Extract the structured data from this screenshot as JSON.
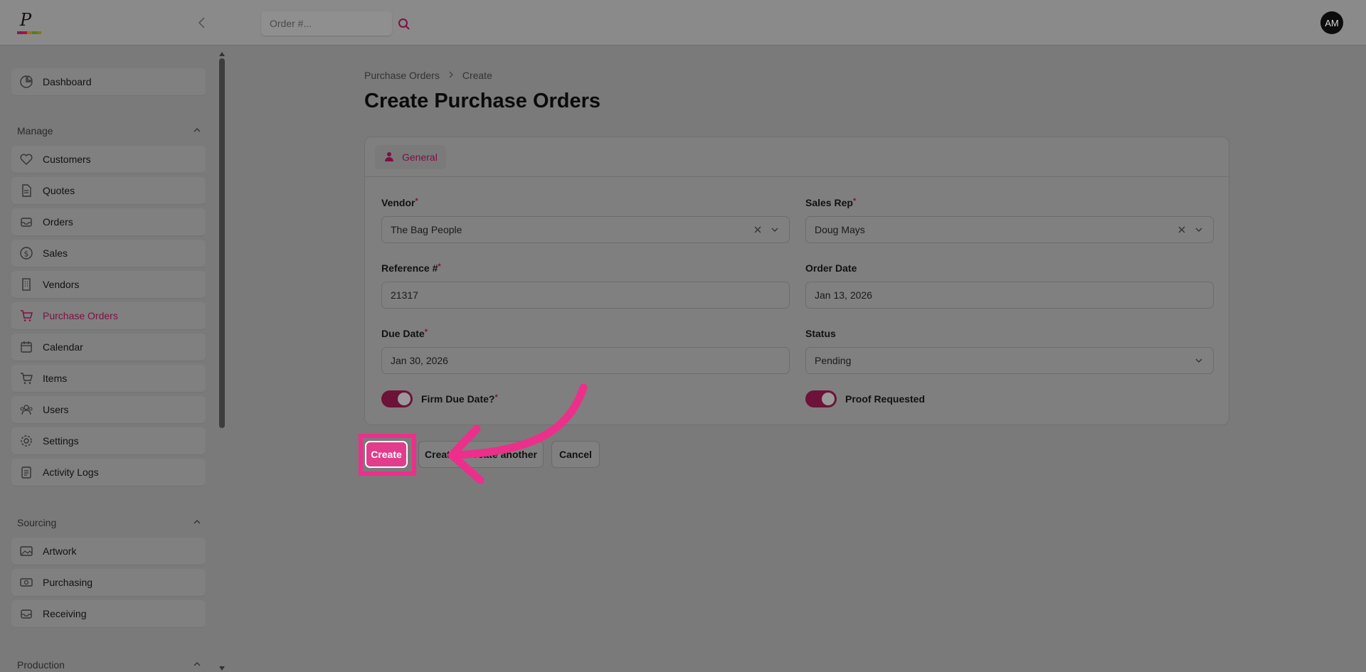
{
  "topbar": {
    "search_placeholder": "Order #...",
    "avatar_initials": "AM"
  },
  "sidebar": {
    "items": [
      {
        "label": "Dashboard",
        "icon": "pie-chart-icon"
      }
    ],
    "sections": [
      {
        "title": "Manage",
        "items": [
          {
            "label": "Customers",
            "icon": "heart-icon"
          },
          {
            "label": "Quotes",
            "icon": "document-icon"
          },
          {
            "label": "Orders",
            "icon": "inbox-icon"
          },
          {
            "label": "Sales",
            "icon": "dollar-icon"
          },
          {
            "label": "Vendors",
            "icon": "building-icon"
          },
          {
            "label": "Purchase Orders",
            "icon": "cart-icon",
            "active": true
          },
          {
            "label": "Calendar",
            "icon": "calendar-icon"
          },
          {
            "label": "Items",
            "icon": "cart-icon"
          },
          {
            "label": "Users",
            "icon": "users-icon"
          },
          {
            "label": "Settings",
            "icon": "gear-icon"
          },
          {
            "label": "Activity Logs",
            "icon": "clipboard-icon"
          }
        ]
      },
      {
        "title": "Sourcing",
        "items": [
          {
            "label": "Artwork",
            "icon": "image-icon"
          },
          {
            "label": "Purchasing",
            "icon": "cash-icon"
          },
          {
            "label": "Receiving",
            "icon": "inbox-icon"
          }
        ]
      },
      {
        "title": "Production",
        "items": []
      }
    ]
  },
  "breadcrumb": [
    "Purchase Orders",
    "Create"
  ],
  "page_title": "Create Purchase Orders",
  "form": {
    "tab_label": "General",
    "vendor": {
      "label": "Vendor",
      "value": "The Bag People",
      "required": true
    },
    "sales_rep": {
      "label": "Sales Rep",
      "value": "Doug Mays",
      "required": true
    },
    "reference": {
      "label": "Reference #",
      "value": "21317",
      "required": true
    },
    "order_date": {
      "label": "Order Date",
      "value": "Jan 13, 2026"
    },
    "due_date": {
      "label": "Due Date",
      "value": "Jan 30, 2026",
      "required": true
    },
    "status": {
      "label": "Status",
      "value": "Pending"
    },
    "firm_due_date": {
      "label": "Firm Due Date?",
      "on": true,
      "required": true
    },
    "proof_requested": {
      "label": "Proof Requested",
      "on": true
    }
  },
  "actions": {
    "create": "Create",
    "create_another": "Create & create another",
    "cancel": "Cancel"
  },
  "colors": {
    "accent": "#e23d8c",
    "highlight": "#ec2f8b",
    "brand_dark": "#7d1043"
  }
}
